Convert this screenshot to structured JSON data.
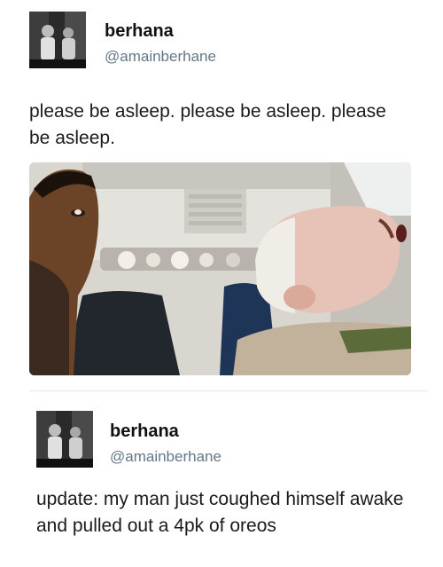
{
  "tweets": [
    {
      "display_name": "berhana",
      "handle": "@amainberhane",
      "text": "please be asleep. please be asleep. please be asleep."
    },
    {
      "display_name": "berhana",
      "handle": "@amainberhane",
      "text": "update: my man just coughed himself awake and pulled out a 4pk of oreos"
    }
  ],
  "icons": {
    "avatar": "profile-photo",
    "photo": "airplane-selfie-photo"
  },
  "colors": {
    "handle": "#657786",
    "text": "#1a1a1a",
    "divider": "#e1e8ed"
  }
}
